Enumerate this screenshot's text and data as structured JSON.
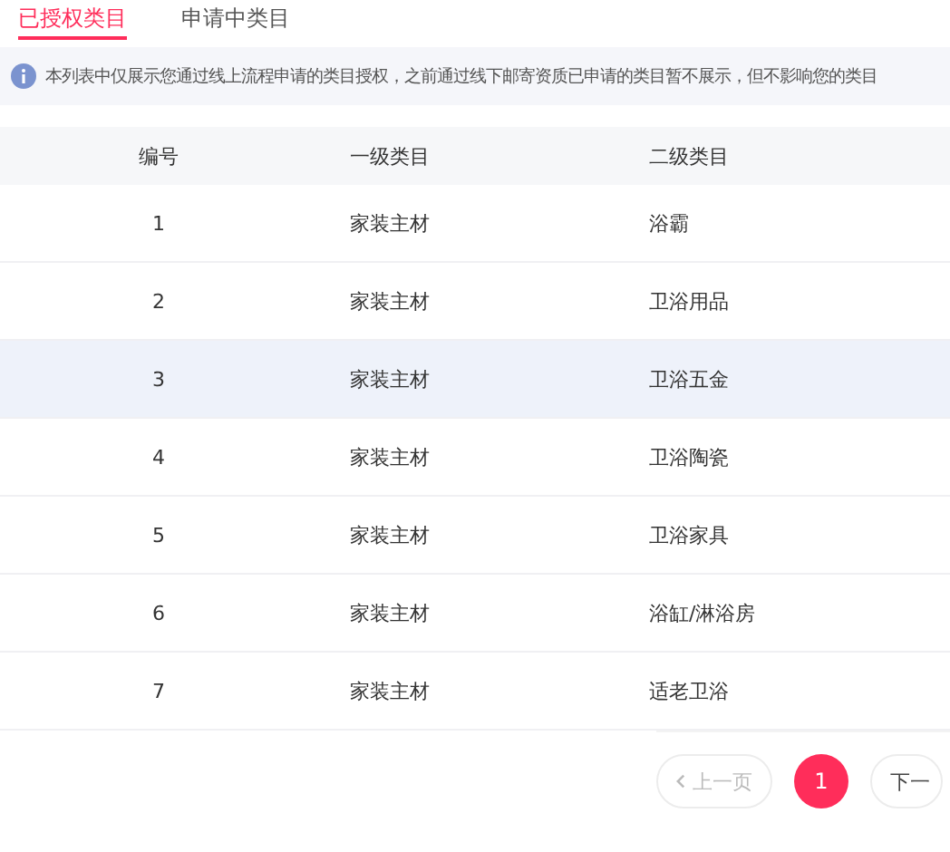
{
  "tabs": [
    {
      "label": "已授权类目",
      "selected": true
    },
    {
      "label": "申请中类目",
      "selected": false
    }
  ],
  "notice": {
    "text": "本列表中仅展示您通过线上流程申请的类目授权，之前通过线下邮寄资质已申请的类目暂不展示，但不影响您的类目"
  },
  "table": {
    "columns": [
      "编号",
      "一级类目",
      "二级类目"
    ],
    "rows": [
      {
        "cells": [
          "1",
          "家装主材",
          "浴霸"
        ],
        "highlighted": false
      },
      {
        "cells": [
          "2",
          "家装主材",
          "卫浴用品"
        ],
        "highlighted": false
      },
      {
        "cells": [
          "3",
          "家装主材",
          "卫浴五金"
        ],
        "highlighted": true
      },
      {
        "cells": [
          "4",
          "家装主材",
          "卫浴陶瓷"
        ],
        "highlighted": false
      },
      {
        "cells": [
          "5",
          "家装主材",
          "卫浴家具"
        ],
        "highlighted": false
      },
      {
        "cells": [
          "6",
          "家装主材",
          "浴缸/淋浴房"
        ],
        "highlighted": false
      },
      {
        "cells": [
          "7",
          "家装主材",
          "适老卫浴"
        ],
        "highlighted": false
      }
    ]
  },
  "pagination": {
    "prev": {
      "label": "上一页",
      "disabled": true
    },
    "pages": [
      {
        "label": "1",
        "selected": true
      }
    ],
    "next": {
      "label": "下一",
      "disabled": false
    }
  }
}
